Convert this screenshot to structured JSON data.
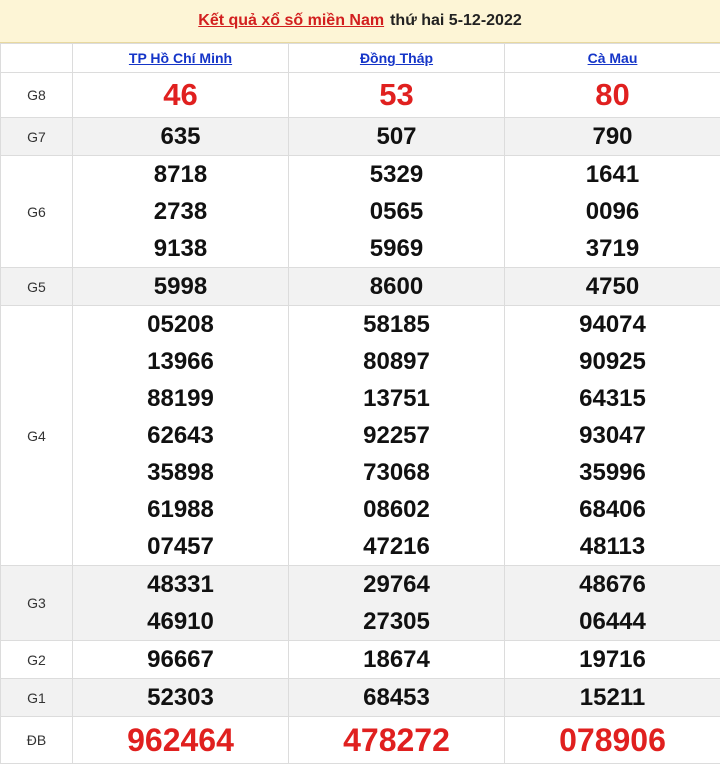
{
  "header": {
    "title_link": "Kết quả xổ số miền Nam",
    "title_rest": "thứ hai 5-12-2022"
  },
  "provinces": [
    "TP Hồ Chí Minh",
    "Đồng Tháp",
    "Cà Mau"
  ],
  "prizes": [
    {
      "label": "G8",
      "values": [
        [
          "46"
        ],
        [
          "53"
        ],
        [
          "80"
        ]
      ]
    },
    {
      "label": "G7",
      "values": [
        [
          "635"
        ],
        [
          "507"
        ],
        [
          "790"
        ]
      ]
    },
    {
      "label": "G6",
      "values": [
        [
          "8718",
          "2738",
          "9138"
        ],
        [
          "5329",
          "0565",
          "5969"
        ],
        [
          "1641",
          "0096",
          "3719"
        ]
      ]
    },
    {
      "label": "G5",
      "values": [
        [
          "5998"
        ],
        [
          "8600"
        ],
        [
          "4750"
        ]
      ]
    },
    {
      "label": "G4",
      "values": [
        [
          "05208",
          "13966",
          "88199",
          "62643",
          "35898",
          "61988",
          "07457"
        ],
        [
          "58185",
          "80897",
          "13751",
          "92257",
          "73068",
          "08602",
          "47216"
        ],
        [
          "94074",
          "90925",
          "64315",
          "93047",
          "35996",
          "68406",
          "48113"
        ]
      ]
    },
    {
      "label": "G3",
      "values": [
        [
          "48331",
          "46910"
        ],
        [
          "29764",
          "27305"
        ],
        [
          "48676",
          "06444"
        ]
      ]
    },
    {
      "label": "G2",
      "values": [
        [
          "96667"
        ],
        [
          "18674"
        ],
        [
          "19716"
        ]
      ]
    },
    {
      "label": "G1",
      "values": [
        [
          "52303"
        ],
        [
          "68453"
        ],
        [
          "15211"
        ]
      ]
    },
    {
      "label": "ĐB",
      "values": [
        [
          "962464"
        ],
        [
          "478272"
        ],
        [
          "078906"
        ]
      ]
    }
  ],
  "colors": {
    "prize_red": "#e0201f",
    "link_blue": "#1535c8",
    "header_bg": "#fdf5d6"
  }
}
